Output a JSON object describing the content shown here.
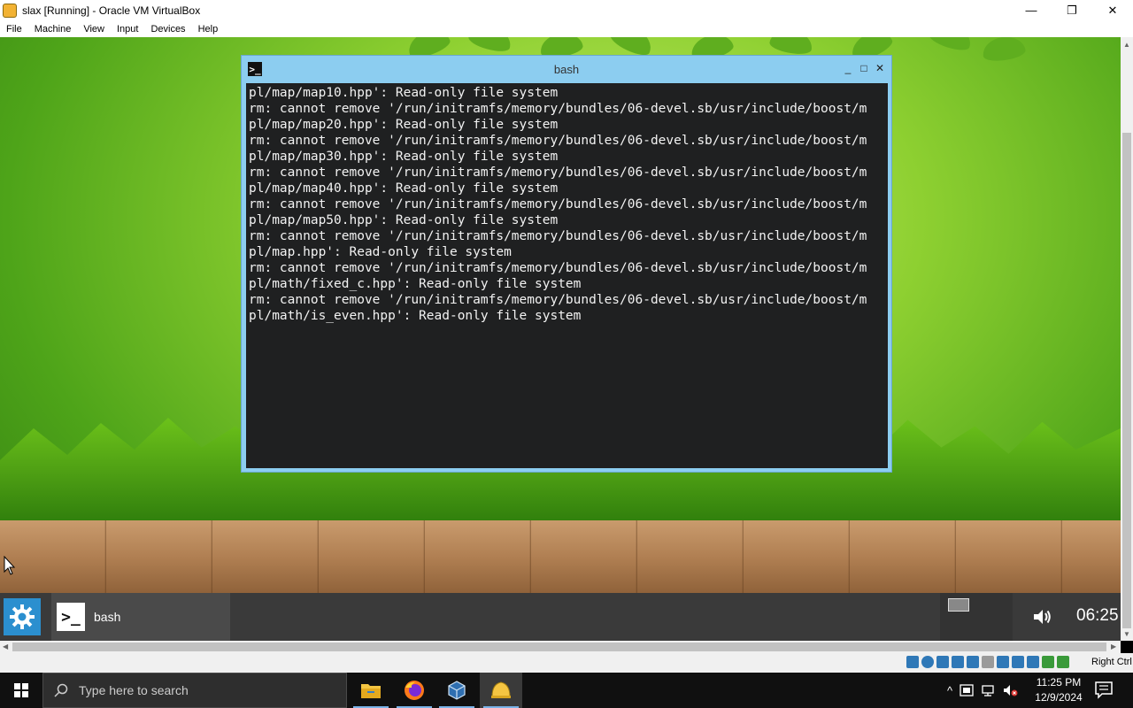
{
  "host_window": {
    "title": "slax [Running] - Oracle VM VirtualBox",
    "minimize": "—",
    "maximize": "❐",
    "close": "✕"
  },
  "menu": [
    "File",
    "Machine",
    "View",
    "Input",
    "Devices",
    "Help"
  ],
  "terminal": {
    "title": "bash",
    "icon_glyph": ">_",
    "controls": {
      "minimize": "_",
      "maximize": "□",
      "close": "✕"
    },
    "lines": [
      "pl/map/map10.hpp': Read-only file system",
      "rm: cannot remove '/run/initramfs/memory/bundles/06-devel.sb/usr/include/boost/m",
      "pl/map/map20.hpp': Read-only file system",
      "rm: cannot remove '/run/initramfs/memory/bundles/06-devel.sb/usr/include/boost/m",
      "pl/map/map30.hpp': Read-only file system",
      "rm: cannot remove '/run/initramfs/memory/bundles/06-devel.sb/usr/include/boost/m",
      "pl/map/map40.hpp': Read-only file system",
      "rm: cannot remove '/run/initramfs/memory/bundles/06-devel.sb/usr/include/boost/m",
      "pl/map/map50.hpp': Read-only file system",
      "rm: cannot remove '/run/initramfs/memory/bundles/06-devel.sb/usr/include/boost/m",
      "pl/map.hpp': Read-only file system",
      "rm: cannot remove '/run/initramfs/memory/bundles/06-devel.sb/usr/include/boost/m",
      "pl/math/fixed_c.hpp': Read-only file system",
      "rm: cannot remove '/run/initramfs/memory/bundles/06-devel.sb/usr/include/boost/m",
      "pl/math/is_even.hpp': Read-only file system"
    ]
  },
  "slax_panel": {
    "task_label": "bash",
    "task_icon_glyph": ">_",
    "clock": "06:25"
  },
  "vb_status": {
    "host_key": "Right Ctrl"
  },
  "win_taskbar": {
    "search_placeholder": "Type here to search",
    "time": "11:25 PM",
    "date": "12/9/2024",
    "tray_chevron": "^"
  },
  "colors": {
    "terminal_bg": "#1f2021",
    "terminal_frame": "#8ccdf0",
    "slax_accent": "#2b8fcf",
    "windows_taskbar": "#101010"
  }
}
